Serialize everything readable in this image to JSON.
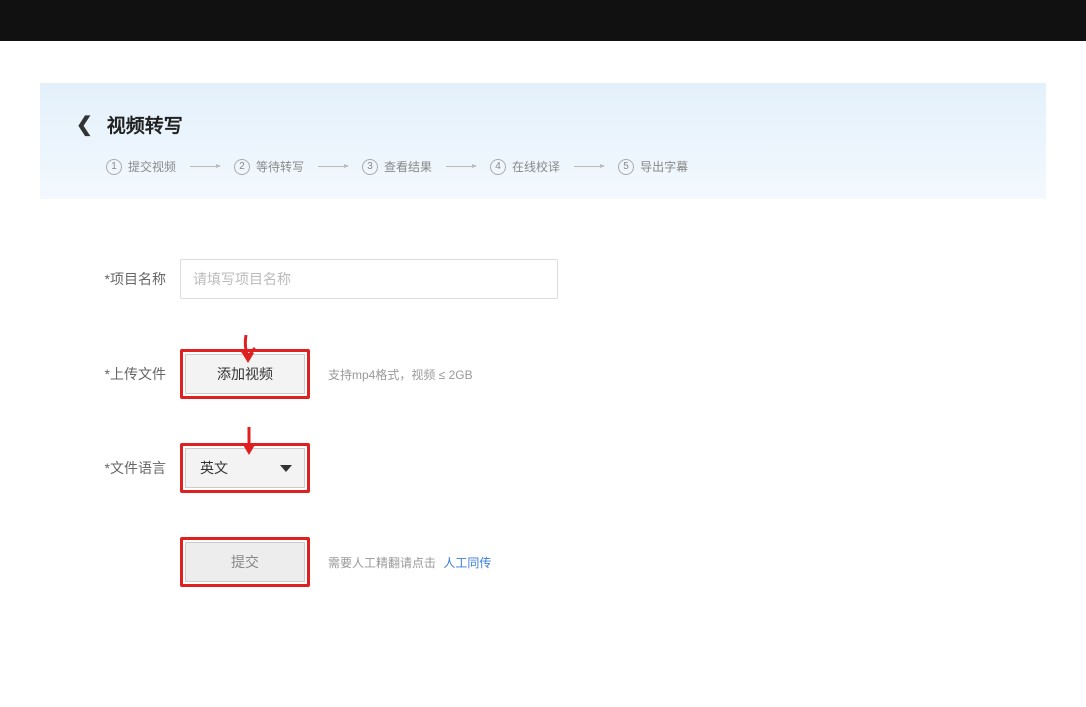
{
  "page": {
    "title": "视频转写"
  },
  "steps": [
    {
      "num": "1",
      "label": "提交视频"
    },
    {
      "num": "2",
      "label": "等待转写"
    },
    {
      "num": "3",
      "label": "查看结果"
    },
    {
      "num": "4",
      "label": "在线校译"
    },
    {
      "num": "5",
      "label": "导出字幕"
    }
  ],
  "form": {
    "project_name_label": "*项目名称",
    "project_name_placeholder": "请填写项目名称",
    "upload_label": "*上传文件",
    "add_video_button": "添加视频",
    "upload_helper": "支持mp4格式，视频 ≤ 2GB",
    "language_label": "*文件语言",
    "language_value": "英文",
    "submit_button": "提交",
    "manual_prefix": "需要人工精翻请点击",
    "manual_link": "人工同传"
  }
}
